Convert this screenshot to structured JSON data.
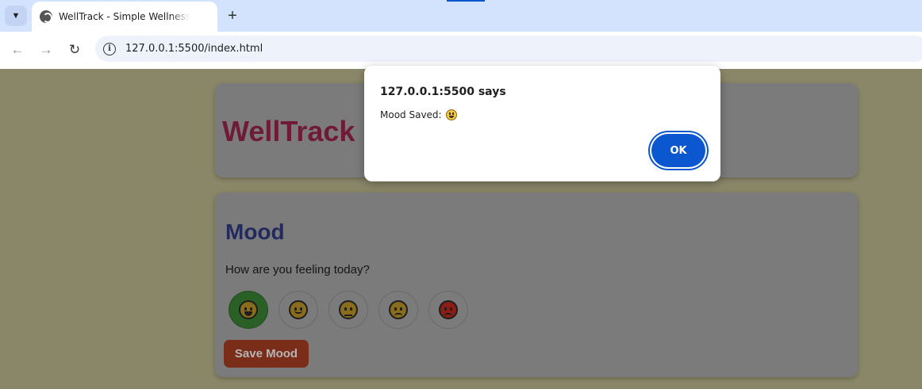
{
  "browser": {
    "tab_title": "WellTrack - Simple Wellness & Habit Tracker",
    "new_tab_symbol": "+",
    "url": "127.0.0.1:5500/index.html"
  },
  "page": {
    "app_title": "WellTrack",
    "mood": {
      "heading": "Mood",
      "question": "How are you feeling today?",
      "options": [
        {
          "icon": "grinning-face-icon",
          "selected": true
        },
        {
          "icon": "smiling-face-icon",
          "selected": false
        },
        {
          "icon": "neutral-face-icon",
          "selected": false
        },
        {
          "icon": "pensive-face-icon",
          "selected": false
        },
        {
          "icon": "angry-face-icon",
          "selected": false
        }
      ],
      "save_label": "Save Mood"
    }
  },
  "dialog": {
    "title": "127.0.0.1:5500 says",
    "message": "Mood Saved:",
    "ok_label": "OK"
  },
  "colors": {
    "overlay_background": "#8a8769",
    "card": "#7b7b7b",
    "title": "#6f1a36",
    "heading": "#232a5e",
    "save_button": "#7a2d18",
    "selected_mood": "#2a5f26",
    "ok_button": "#0b57d0"
  }
}
